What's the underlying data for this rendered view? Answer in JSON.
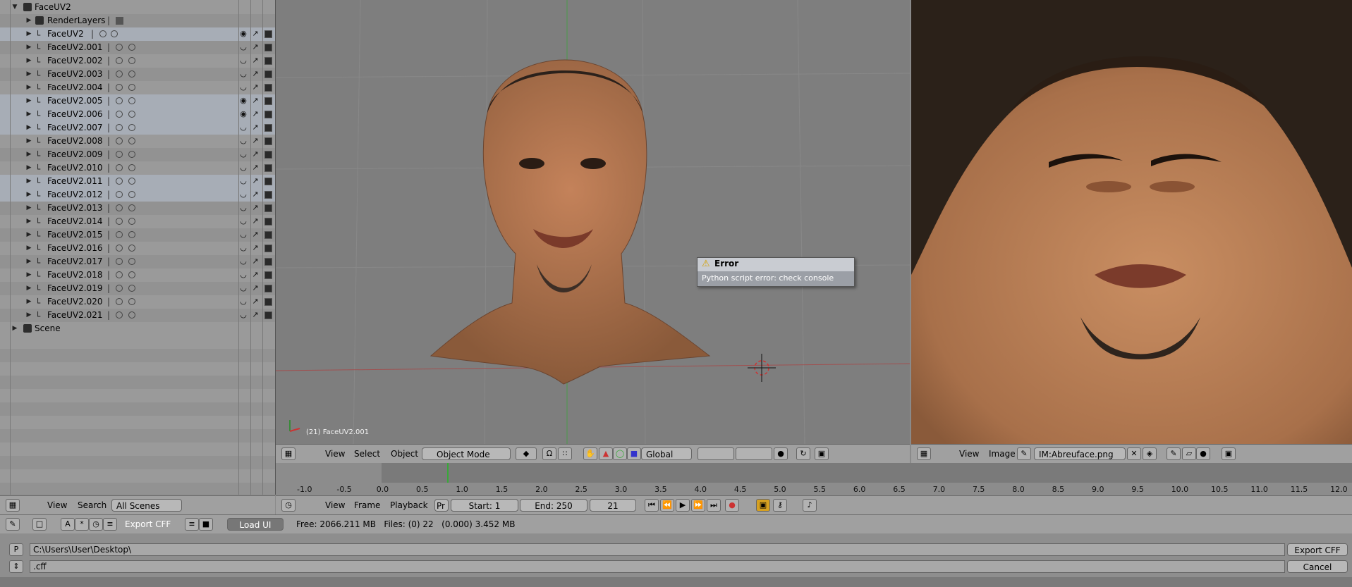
{
  "outliner": {
    "root": "FaceUV2",
    "renderlayers": "RenderLayers",
    "objects": [
      "FaceUV2",
      "FaceUV2.001",
      "FaceUV2.002",
      "FaceUV2.003",
      "FaceUV2.004",
      "FaceUV2.005",
      "FaceUV2.006",
      "FaceUV2.007",
      "FaceUV2.008",
      "FaceUV2.009",
      "FaceUV2.010",
      "FaceUV2.011",
      "FaceUV2.012",
      "FaceUV2.013",
      "FaceUV2.014",
      "FaceUV2.015",
      "FaceUV2.016",
      "FaceUV2.017",
      "FaceUV2.018",
      "FaceUV2.019",
      "FaceUV2.020",
      "FaceUV2.021"
    ],
    "scene": "Scene",
    "header": {
      "view": "View",
      "search": "Search",
      "scenes": "All Scenes"
    }
  },
  "viewport": {
    "object_label": "(21) FaceUV2.001",
    "header": {
      "view": "View",
      "select": "Select",
      "object": "Object",
      "mode": "Object Mode",
      "orientation": "Global"
    }
  },
  "error": {
    "title": "Error",
    "message": "Python script error: check console"
  },
  "image_editor": {
    "header": {
      "view": "View",
      "image": "Image",
      "image_name": "IM:Abreuface.png"
    }
  },
  "timeline": {
    "ticks": [
      "-1.0",
      "-0.5",
      "0.0",
      "0.5",
      "1.0",
      "1.5",
      "2.0",
      "2.5",
      "3.0",
      "3.5",
      "4.0",
      "4.5",
      "5.0",
      "5.5",
      "6.0",
      "6.5",
      "7.0",
      "7.5",
      "8.0",
      "8.5",
      "9.0",
      "9.5",
      "10.0",
      "10.5",
      "11.0",
      "11.5",
      "12.0"
    ],
    "header": {
      "view": "View",
      "frame": "Frame",
      "playback": "Playback",
      "pr": "Pr",
      "start": "Start: 1",
      "end": "End: 250",
      "current": "21"
    }
  },
  "filebrowser": {
    "export_cff": "Export CFF",
    "load_ui": "Load UI",
    "info": "Free: 2066.211 MB   Files: (0) 22   (0.000) 3.452 MB",
    "path": "C:\\Users\\User\\Desktop\\",
    "filename": ".cff",
    "export_button": "Export CFF",
    "cancel_button": "Cancel"
  }
}
